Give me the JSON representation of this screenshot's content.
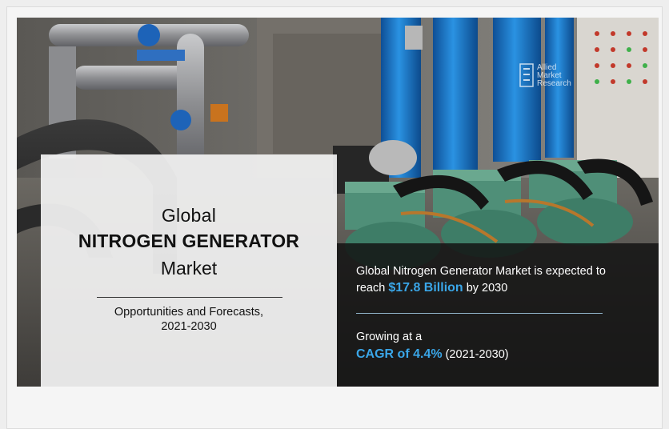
{
  "card": {
    "line1": "Global",
    "line2": "NITROGEN GENERATOR",
    "line3": "Market",
    "sub1": "Opportunities and Forecasts,",
    "sub2": "2021-2030"
  },
  "stats": {
    "line1": "Global Nitrogen Generator Market is expected to",
    "reach_prefix": "reach ",
    "market_value": "$17.8 Billion",
    "reach_suffix": " by 2030",
    "growing": "Growing at a",
    "cagr": "CAGR of 4.4%",
    "period": " (2021-2030)"
  },
  "logo": {
    "line1": "Allied",
    "line2": "Market",
    "line3": "Research"
  },
  "colors": {
    "accent": "#3aa6e8",
    "panel": "#121212",
    "card": "#f2f2f2",
    "tank_blue": "#1f7fcf",
    "compressor_green": "#4f8f78"
  }
}
